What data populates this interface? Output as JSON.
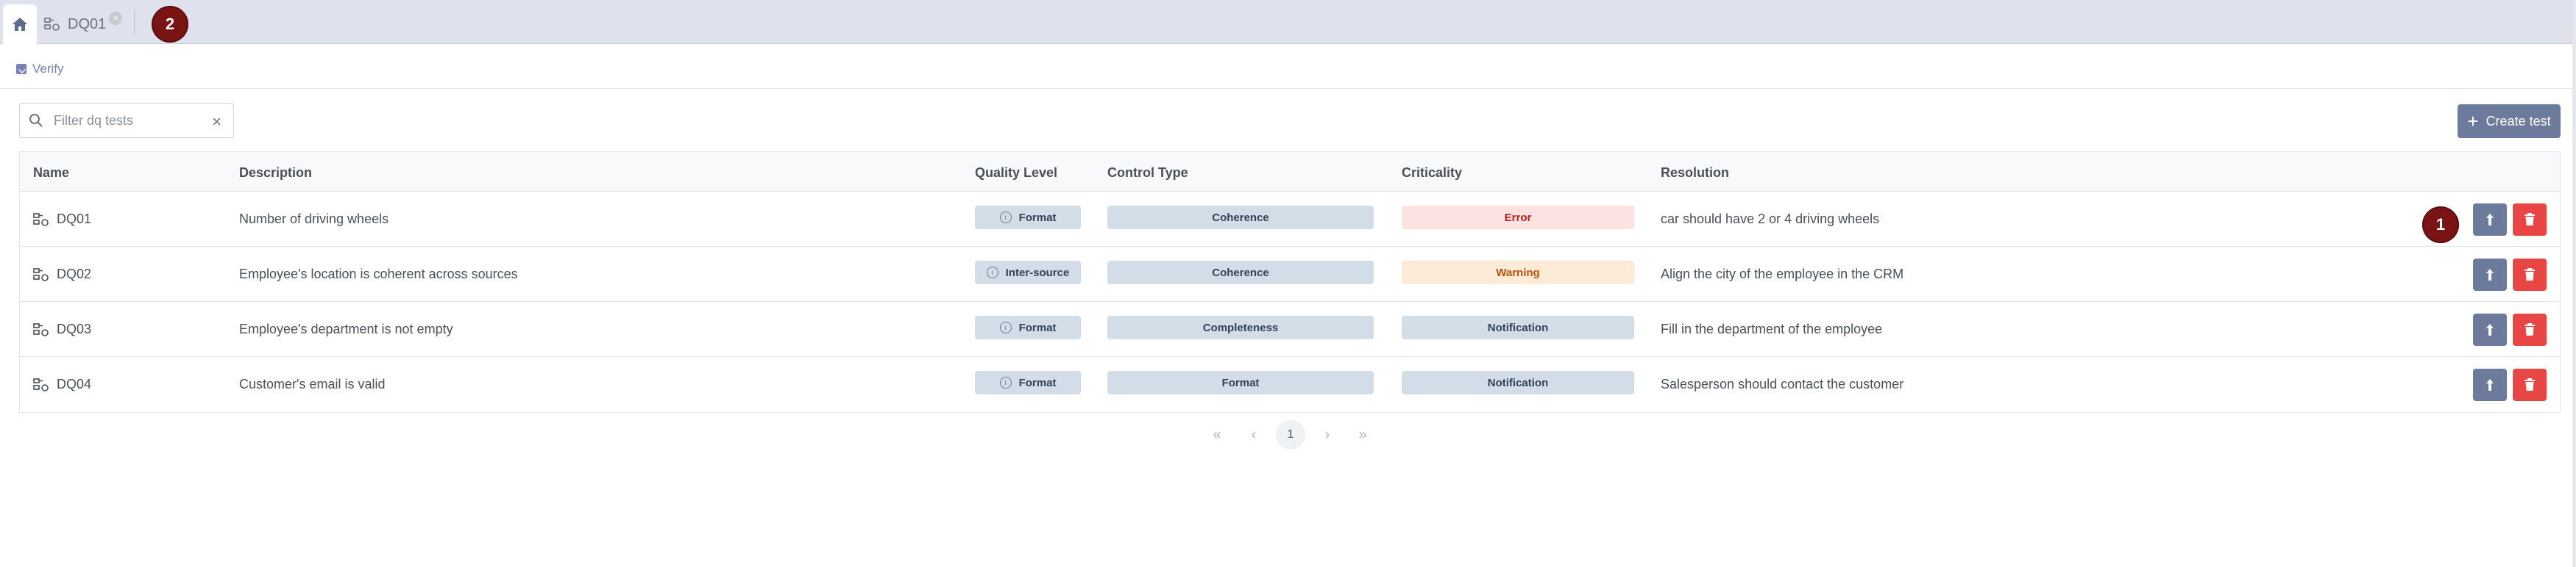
{
  "tabs": {
    "home_icon": "home-icon",
    "items": [
      {
        "label": "DQ01",
        "icon": "dq-test-icon",
        "close": "×"
      }
    ]
  },
  "markers": {
    "tab_marker": "2",
    "row_marker": "1"
  },
  "breadcrumb": {
    "label": "Verify",
    "icon": "check-square-icon"
  },
  "search": {
    "placeholder": "Filter dq tests",
    "value": "",
    "clear": "×"
  },
  "toolbar": {
    "create_label": "Create test",
    "create_icon": "plus-icon"
  },
  "table": {
    "headers": {
      "name": "Name",
      "description": "Description",
      "quality_level": "Quality Level",
      "control_type": "Control Type",
      "criticality": "Criticality",
      "resolution": "Resolution"
    },
    "rows": [
      {
        "name": "DQ01",
        "description": "Number of driving wheels",
        "quality_level": "Format",
        "control_type": "Coherence",
        "criticality": "Error",
        "resolution": "car should have 2 or 4 driving wheels"
      },
      {
        "name": "DQ02",
        "description": "Employee's location is coherent across sources",
        "quality_level": "Inter-source",
        "control_type": "Coherence",
        "criticality": "Warning",
        "resolution": "Align the city of the employee in the CRM"
      },
      {
        "name": "DQ03",
        "description": "Employee's department is not empty",
        "quality_level": "Format",
        "control_type": "Completeness",
        "criticality": "Notification",
        "resolution": "Fill in the department of the employee"
      },
      {
        "name": "DQ04",
        "description": "Customer's email is valid",
        "quality_level": "Format",
        "control_type": "Format",
        "criticality": "Notification",
        "resolution": "Salesperson should contact the customer"
      }
    ]
  },
  "pagination": {
    "first": "«",
    "prev": "‹",
    "current": "1",
    "next": "›",
    "last": "»"
  },
  "colors": {
    "tabbar_bg": "#dfe2ed",
    "primary_button": "#6c7a9c",
    "delete_button": "#e84545",
    "marker": "#7a1414",
    "error_bg": "#fde2e2",
    "warning_bg": "#fdebd7",
    "neutral_pill": "#d3dde8"
  }
}
